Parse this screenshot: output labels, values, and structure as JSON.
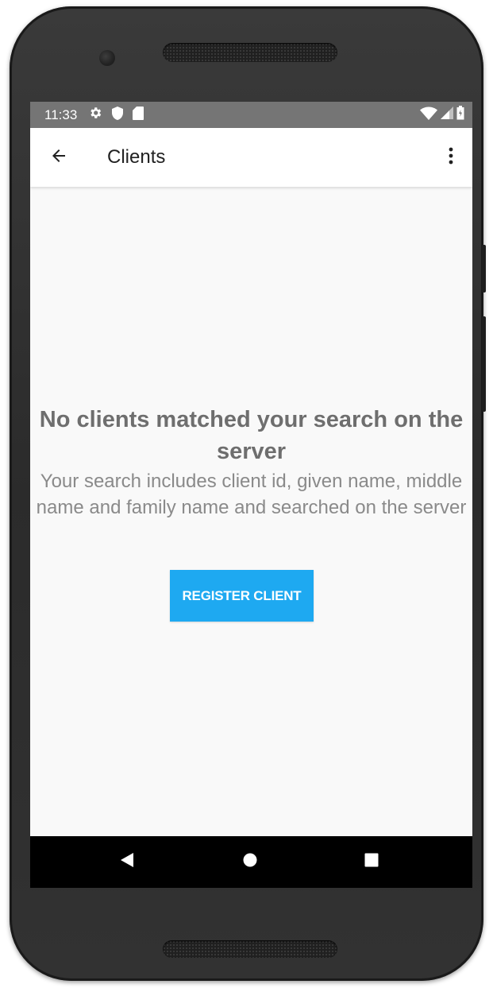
{
  "status_bar": {
    "time": "11:33",
    "left_icons": [
      "gear-icon",
      "shield-icon",
      "sd-card-icon"
    ],
    "right_icons": [
      "wifi-icon",
      "signal-icon",
      "battery-icon"
    ]
  },
  "app_bar": {
    "title": "Clients",
    "back_icon": "arrow-back-icon",
    "menu_icon": "more-vert-icon"
  },
  "empty_state": {
    "title": "No clients matched your search on the server",
    "description": "Your search includes client id, given name, middle name and family name and searched on the server",
    "button_label": "REGISTER CLIENT"
  },
  "nav_bar": {
    "items": [
      "back-triangle-icon",
      "home-circle-icon",
      "recents-square-icon"
    ]
  },
  "colors": {
    "accent": "#1ea9f1",
    "status_bar": "#757575",
    "background": "#f9f9f9",
    "nav_bar": "#000000"
  }
}
